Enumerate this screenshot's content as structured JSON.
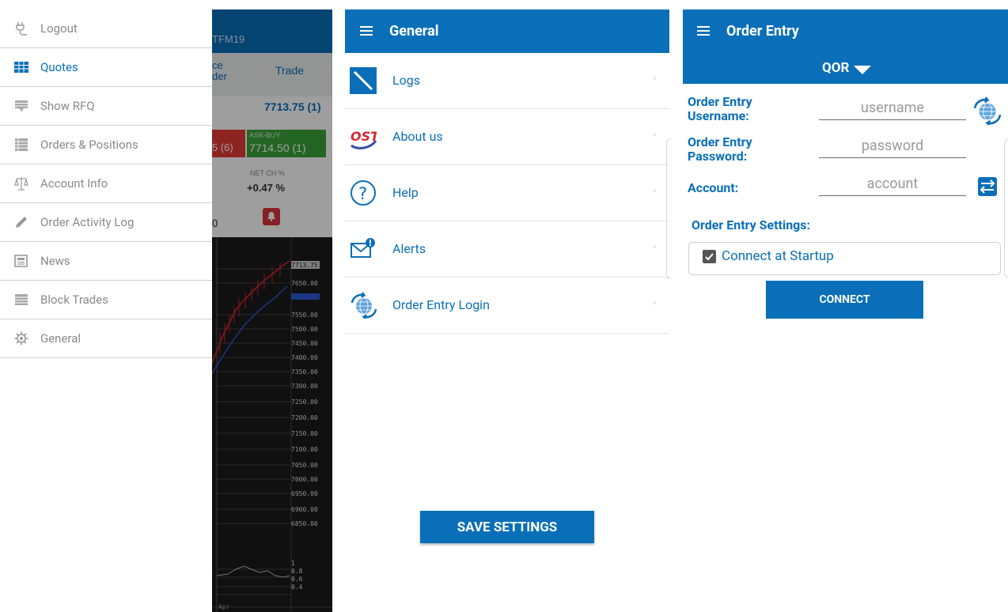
{
  "colors": {
    "accent": "#0a6fb8",
    "bid_red": "#e43b34",
    "ask_green": "#3ba43b"
  },
  "drawer": {
    "items": [
      {
        "label": "Logout",
        "icon": "plug-icon"
      },
      {
        "label": "Quotes",
        "icon": "grid-icon",
        "active": true
      },
      {
        "label": "Show RFQ",
        "icon": "rfq-icon"
      },
      {
        "label": "Orders & Positions",
        "icon": "orders-icon"
      },
      {
        "label": "Account Info",
        "icon": "scales-icon"
      },
      {
        "label": "Order Activity Log",
        "icon": "pencil-icon"
      },
      {
        "label": "News",
        "icon": "newspaper-icon"
      },
      {
        "label": "Block Trades",
        "icon": "block-icon"
      },
      {
        "label": "General",
        "icon": "gear-icon"
      }
    ]
  },
  "background_app": {
    "symbol": "TFM19",
    "tab_left_line1": "ce",
    "tab_left_line2": "der",
    "tab_trade": "Trade",
    "last_price": "7713.75 (1)",
    "bid_fragment": "5 (6)",
    "ask_label": "ASK-BUY",
    "ask_value": "7714.50 (1)",
    "net_label": "NET CH %",
    "net_value": "+0.47 %",
    "row_fragment": "0",
    "price_ticks": [
      "7713.75",
      "7650.00",
      "7550.00",
      "7500.00",
      "7450.00",
      "7400.00",
      "7350.00",
      "7300.00",
      "7250.00",
      "7200.00",
      "7150.00",
      "7100.00",
      "7050.00",
      "7000.00",
      "6950.00",
      "6900.00",
      "6850.00"
    ],
    "indicator_ticks": [
      "1",
      "0.8",
      "0.6",
      "0.4"
    ],
    "month_label": "Apr"
  },
  "general": {
    "title": "General",
    "rows": [
      {
        "label": "Logs",
        "icon": "logs-icon"
      },
      {
        "label": "About us",
        "icon": "ost-logo-icon"
      },
      {
        "label": "Help",
        "icon": "help-icon"
      },
      {
        "label": "Alerts",
        "icon": "alert-mail-icon"
      },
      {
        "label": "Order Entry Login",
        "icon": "globe-arrows-icon"
      }
    ],
    "save_label": "SAVE SETTINGS"
  },
  "order_entry": {
    "title": "Order Entry",
    "exchange": "QOR",
    "username_label_1": "Order Entry",
    "username_label_2": "Username:",
    "username_placeholder": "username",
    "password_label_1": "Order Entry",
    "password_label_2": "Password:",
    "password_placeholder": "password",
    "account_label": "Account:",
    "account_placeholder": "account",
    "settings_label": "Order Entry Settings:",
    "connect_startup_label": "Connect at Startup",
    "connect_startup_checked": true,
    "connect_label": "CONNECT"
  }
}
